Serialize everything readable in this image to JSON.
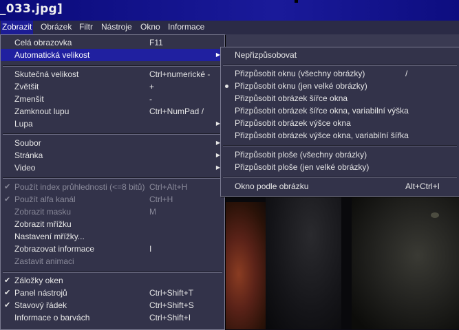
{
  "window": {
    "title": "_033.jpg]"
  },
  "menubar": {
    "items": [
      {
        "label": "Zobrazit"
      },
      {
        "label": "Obrázek"
      },
      {
        "label": "Filtr"
      },
      {
        "label": "Nástroje"
      },
      {
        "label": "Okno"
      },
      {
        "label": "Informace"
      }
    ]
  },
  "view_menu": {
    "items": [
      {
        "label": "Celá obrazovka",
        "shortcut": "F11"
      },
      {
        "label": "Automatická velikost",
        "shortcut": ""
      },
      {
        "label": "Skutečná velikost",
        "shortcut": "Ctrl+numerické -"
      },
      {
        "label": "Zvětšit",
        "shortcut": "+"
      },
      {
        "label": "Zmenšit",
        "shortcut": "-"
      },
      {
        "label": "Zamknout lupu",
        "shortcut": "Ctrl+NumPad /"
      },
      {
        "label": "Lupa",
        "shortcut": ""
      },
      {
        "label": "Soubor",
        "shortcut": ""
      },
      {
        "label": "Stránka",
        "shortcut": ""
      },
      {
        "label": "Video",
        "shortcut": ""
      },
      {
        "label": "Použít index průhlednosti (<=8 bitů)",
        "shortcut": "Ctrl+Alt+H"
      },
      {
        "label": "Použít alfa kanál",
        "shortcut": "Ctrl+H"
      },
      {
        "label": "Zobrazit masku",
        "shortcut": "M"
      },
      {
        "label": "Zobrazit mřížku",
        "shortcut": ""
      },
      {
        "label": "Nastavení mřížky...",
        "shortcut": ""
      },
      {
        "label": "Zobrazovat informace",
        "shortcut": "I"
      },
      {
        "label": "Zastavit animaci",
        "shortcut": ""
      },
      {
        "label": "Záložky oken",
        "shortcut": ""
      },
      {
        "label": "Panel nástrojů",
        "shortcut": "Ctrl+Shift+T"
      },
      {
        "label": "Stavový řádek",
        "shortcut": "Ctrl+Shift+S"
      },
      {
        "label": "Informace o barvách",
        "shortcut": "Ctrl+Shift+I"
      }
    ]
  },
  "autosize_submenu": {
    "items": [
      {
        "label": "Nepřizpůsobovat",
        "shortcut": ""
      },
      {
        "label": "Přizpůsobit oknu (všechny obrázky)",
        "shortcut": "/"
      },
      {
        "label": "Přizpůsobit oknu (jen velké obrázky)",
        "shortcut": ""
      },
      {
        "label": "Přizpůsobit obrázek šířce okna",
        "shortcut": ""
      },
      {
        "label": "Přizpůsobit obrázek šířce okna, variabilní výška",
        "shortcut": ""
      },
      {
        "label": "Přizpůsobit obrázek výšce okna",
        "shortcut": ""
      },
      {
        "label": "Přizpůsobit obrázek výšce okna, variabilní šířka",
        "shortcut": ""
      },
      {
        "label": "Přizpůsobit ploše (všechny obrázky)",
        "shortcut": ""
      },
      {
        "label": "Přizpůsobit ploše (jen velké obrázky)",
        "shortcut": ""
      },
      {
        "label": "Okno podle obrázku",
        "shortcut": "Alt+Ctrl+I"
      }
    ]
  },
  "icons": {
    "check": "check-icon",
    "submenu_arrow": "submenu-arrow-icon",
    "radio_bullet": "radio-bullet-icon"
  }
}
